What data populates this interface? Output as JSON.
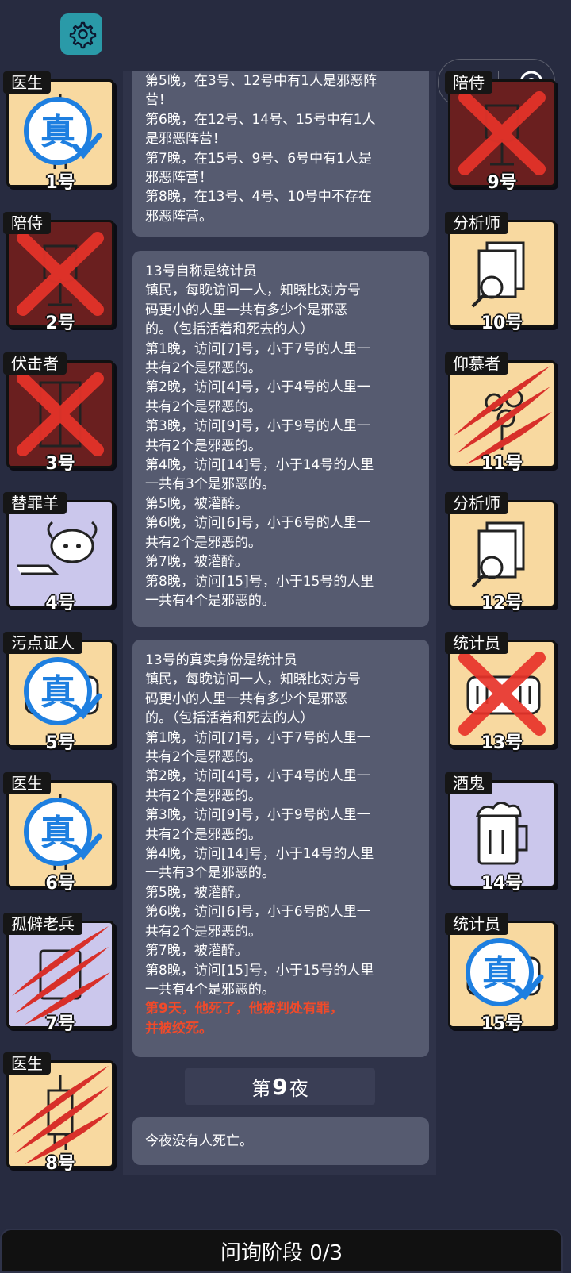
{
  "settings_icon": "gear-icon",
  "capsule": {
    "more_icon": "more-dots-icon",
    "close_icon": "record-icon"
  },
  "players": [
    {
      "num": "1号",
      "role": "医生",
      "bg": "orange",
      "status": "true-mark"
    },
    {
      "num": "2号",
      "role": "陪侍",
      "bg": "dead",
      "status": "x-mark"
    },
    {
      "num": "3号",
      "role": "伏击者",
      "bg": "dead",
      "status": "x-mark"
    },
    {
      "num": "4号",
      "role": "替罪羊",
      "bg": "purple",
      "status": "none"
    },
    {
      "num": "5号",
      "role": "污点证人",
      "bg": "orange",
      "status": "true-mark"
    },
    {
      "num": "6号",
      "role": "医生",
      "bg": "orange",
      "status": "true-mark"
    },
    {
      "num": "7号",
      "role": "孤僻老兵",
      "bg": "purple",
      "status": "claw-mark"
    },
    {
      "num": "8号",
      "role": "医生",
      "bg": "orange",
      "status": "claw-mark"
    },
    {
      "num": "9号",
      "role": "陪侍",
      "bg": "dead",
      "status": "x-mark"
    },
    {
      "num": "10号",
      "role": "分析师",
      "bg": "orange",
      "status": "none"
    },
    {
      "num": "11号",
      "role": "仰慕者",
      "bg": "orange",
      "status": "claw-mark"
    },
    {
      "num": "12号",
      "role": "分析师",
      "bg": "orange",
      "status": "none"
    },
    {
      "num": "13号",
      "role": "统计员",
      "bg": "orange",
      "status": "x-mark"
    },
    {
      "num": "14号",
      "role": "酒鬼",
      "bg": "purple",
      "status": "none"
    },
    {
      "num": "15号",
      "role": "统计员",
      "bg": "orange",
      "status": "true-mark"
    }
  ],
  "feed": {
    "msg1": [
      "第5晚，在3号、12号中有1人是邪恶阵",
      "营！",
      "第6晚，在12号、14号、15号中有1人",
      "是邪恶阵营！",
      "第7晚，在15号、9号、6号中有1人是",
      "邪恶阵营！",
      "第8晚，在13号、4号、10号中不存在",
      "邪恶阵营。"
    ],
    "msg2": [
      "13号自称是统计员",
      "镇民，每晚访问一人，知晓比对方号",
      "码更小的人里一共有多少个是邪恶",
      "的。（包括活着和死去的人）",
      "第1晚，访问[7]号，小于7号的人里一",
      "共有2个是邪恶的。",
      "第2晚，访问[4]号，小于4号的人里一",
      "共有2个是邪恶的。",
      "第3晚，访问[9]号，小于9号的人里一",
      "共有2个是邪恶的。",
      "第4晚，访问[14]号，小于14号的人里",
      "一共有3个是邪恶的。",
      "第5晚，被灌醉。",
      "第6晚，访问[6]号，小于6号的人里一",
      "共有2个是邪恶的。",
      "第7晚，被灌醉。",
      "第8晚，访问[15]号，小于15号的人里",
      "一共有4个是邪恶的。"
    ],
    "msg3": [
      "13号的真实身份是统计员",
      "镇民，每晚访问一人，知晓比对方号",
      "码更小的人里一共有多少个是邪恶",
      "的。（包括活着和死去的人）",
      "第1晚，访问[7]号，小于7号的人里一",
      "共有2个是邪恶的。",
      "第2晚，访问[4]号，小于4号的人里一",
      "共有2个是邪恶的。",
      "第3晚，访问[9]号，小于9号的人里一",
      "共有2个是邪恶的。",
      "第4晚，访问[14]号，小于14号的人里",
      "一共有3个是邪恶的。",
      "第5晚，被灌醉。",
      "第6晚，访问[6]号，小于6号的人里一",
      "共有2个是邪恶的。",
      "第7晚，被灌醉。",
      "第8晚，访问[15]号，小于15号的人里",
      "一共有4个是邪恶的。"
    ],
    "msg3_red": [
      "第9天，他死了，他被判处有罪，",
      "并被绞死。"
    ],
    "night_prefix": "第",
    "night_number": "9",
    "night_suffix": "夜",
    "msg4": "今夜没有人死亡。"
  },
  "bottom_bar": "问询阶段 0/3",
  "colors": {
    "page_bg": "#272b40",
    "bubble": "#565b70",
    "accent_red": "#f04a2a",
    "teal": "#2a9aa8",
    "true_blue": "#1e7fe0"
  }
}
